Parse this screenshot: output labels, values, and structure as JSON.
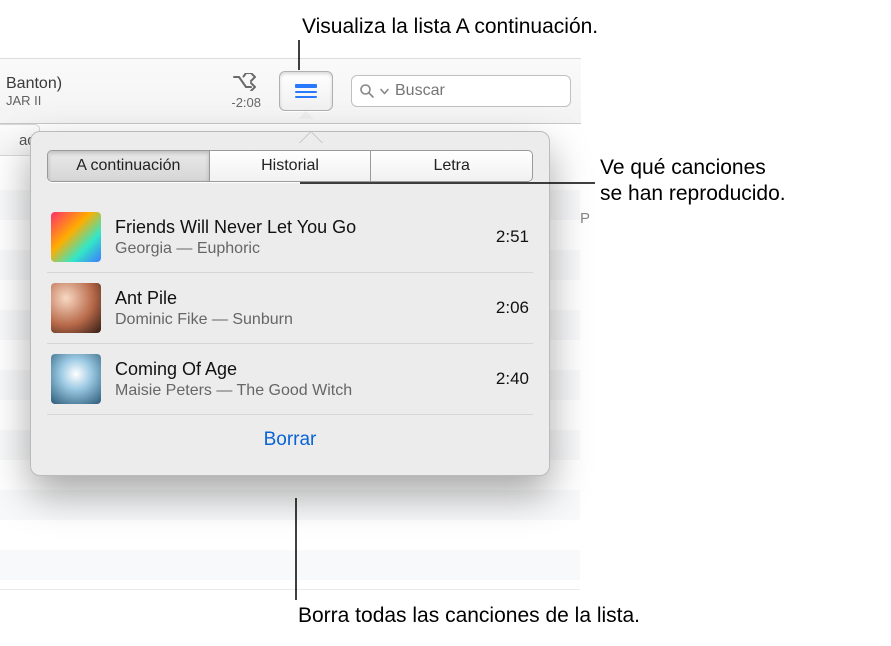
{
  "now_playing": {
    "title_fragment": "Banton)",
    "subtitle_fragment": "JAR II",
    "time_remaining": "-2:08"
  },
  "search": {
    "placeholder": "Buscar"
  },
  "background": {
    "side_fragment": "adi",
    "column_letter": "P"
  },
  "popover": {
    "tabs": {
      "up_next": "A continuación",
      "history": "Historial",
      "lyrics": "Letra"
    },
    "tracks": [
      {
        "title": "Friends Will Never Let You Go",
        "subtitle": "Georgia — Euphoric",
        "duration": "2:51"
      },
      {
        "title": "Ant Pile",
        "subtitle": "Dominic Fike — Sunburn",
        "duration": "2:06"
      },
      {
        "title": "Coming Of Age",
        "subtitle": "Maisie Peters — The Good Witch",
        "duration": "2:40"
      }
    ],
    "clear_label": "Borrar"
  },
  "callouts": {
    "top": "Visualiza la lista A continuación.",
    "right_1": "Ve qué canciones",
    "right_2": "se han reproducido.",
    "bottom": "Borra todas las canciones de la lista."
  }
}
